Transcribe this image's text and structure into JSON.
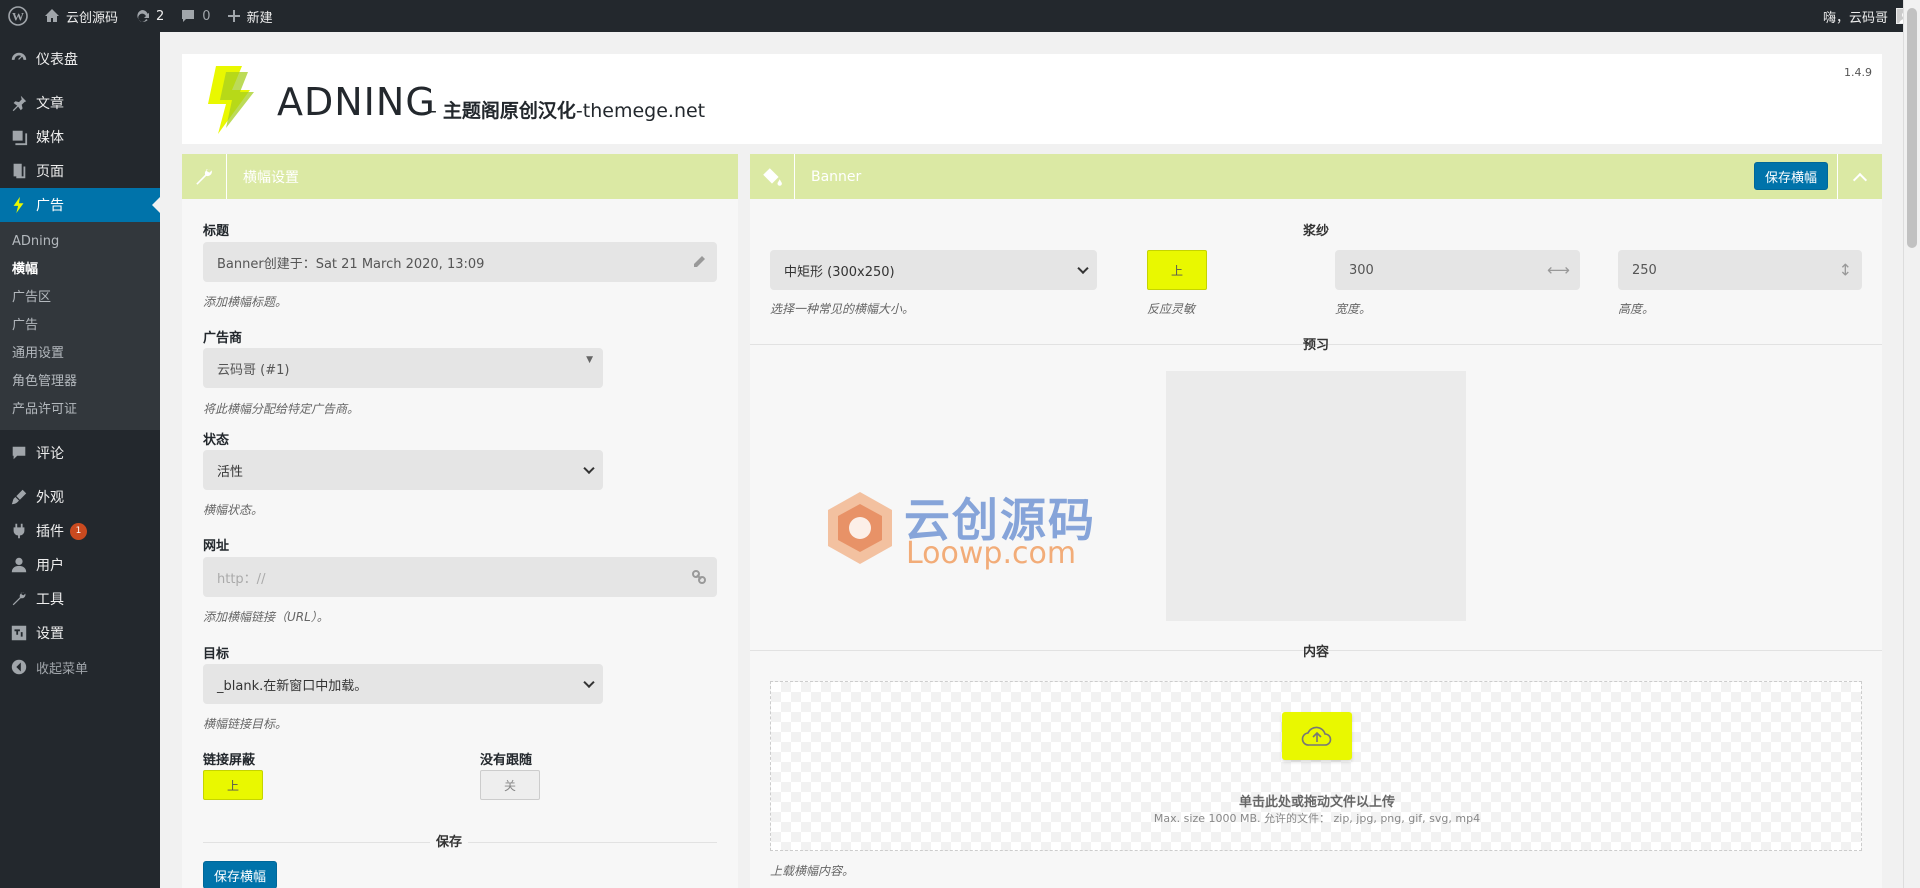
{
  "adminbar": {
    "site_name": "云创源码",
    "updates_count": "2",
    "comments_count": "0",
    "new_label": "新建",
    "greeting": "嗨，云码哥"
  },
  "sidebar": {
    "items_top": [
      {
        "label": "仪表盘",
        "icon": "dashboard-icon"
      }
    ],
    "items_mid": [
      {
        "label": "文章",
        "icon": "pin-icon"
      },
      {
        "label": "媒体",
        "icon": "media-icon"
      },
      {
        "label": "页面",
        "icon": "page-icon"
      },
      {
        "label": "广告",
        "icon": "bolt-icon"
      }
    ],
    "submenu": [
      "ADning",
      "横幅",
      "广告区",
      "广告",
      "通用设置",
      "角色管理器",
      "产品许可证"
    ],
    "items_bottom": [
      {
        "label": "评论",
        "icon": "comment-icon"
      },
      {
        "label": "外观",
        "icon": "brush-icon"
      },
      {
        "label": "插件",
        "icon": "plugin-icon",
        "badge": "1"
      },
      {
        "label": "用户",
        "icon": "user-icon"
      },
      {
        "label": "工具",
        "icon": "wrench-icon"
      },
      {
        "label": "设置",
        "icon": "settings-icon"
      }
    ],
    "collapse_label": "收起菜单"
  },
  "header": {
    "brand": "ADNING",
    "brand_sep": " - ",
    "brand_cn": "主题阁原创汉化",
    "brand_site": "-themege.net",
    "version": "1.4.9"
  },
  "left_panel": {
    "title": "横幅设置",
    "title_label": "标题",
    "title_value": "Banner创建于：Sat 21 March 2020, 13:09",
    "title_help": "添加横幅标题。",
    "advertiser_label": "广告商",
    "advertiser_value": "云码哥 (#1)",
    "advertiser_help": "将此横幅分配给特定广告商。",
    "status_label": "状态",
    "status_value": "活性",
    "status_help": "横幅状态。",
    "url_label": "网址",
    "url_placeholder": "http：//",
    "url_help": "添加横幅链接（URL）。",
    "target_label": "目标",
    "target_value": "_blank.在新窗口中加载。",
    "target_help": "横幅链接目标。",
    "link_mask_label": "链接屏蔽",
    "link_mask_value": "上",
    "nofollow_label": "没有跟随",
    "nofollow_value": "关",
    "save_section": "保存",
    "save_button": "保存横幅"
  },
  "right_panel": {
    "title": "Banner",
    "save_button": "保存横幅",
    "size_section": "浆纱",
    "size_value": "中矩形 (300x250)",
    "size_help": "选择一种常见的横幅大小。",
    "responsive_value": "上",
    "responsive_help": "反应灵敏",
    "width_value": "300",
    "width_help": "宽度。",
    "height_value": "250",
    "height_help": "高度。",
    "preview_section": "预习",
    "content_section": "内容",
    "upload_text": "单击此处或拖动文件以上传",
    "upload_sub": "Max. size 1000 MB. 允许的文件： zip, jpg, png, gif, svg, mp4",
    "content_help": "上载横幅内容。"
  },
  "watermark": {
    "cn": "云创源码",
    "en": "Loowp.com"
  },
  "colors": {
    "accent_blue": "#0073aa",
    "lime": "#e9f800",
    "panel_header": "#dbe9a4",
    "sidebar": "#23282d"
  }
}
